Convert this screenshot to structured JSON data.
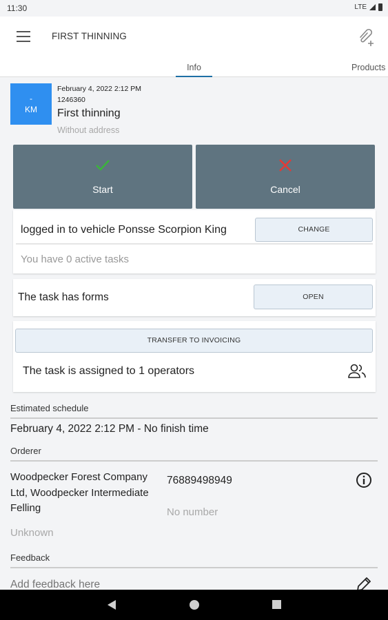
{
  "status_bar": {
    "time": "11:30",
    "network": "LTE"
  },
  "app_bar": {
    "title": "FIRST THINNING"
  },
  "tabs": [
    {
      "label": "Info"
    },
    {
      "label": "Products"
    }
  ],
  "task": {
    "avatar_top": "-",
    "avatar_bottom": "KM",
    "avatar_color": "#2f8ff0",
    "date": "February 4, 2022 2:12 PM",
    "number": "1246360",
    "name": "First thinning",
    "address": "Without address"
  },
  "actions": {
    "start_label": "Start",
    "start_color": "#3ab53a",
    "cancel_label": "Cancel",
    "cancel_color": "#e53935"
  },
  "vehicle": {
    "text": "logged in to vehicle Ponsse Scorpion King",
    "change_label": "CHANGE",
    "active_tasks": "You have 0 active tasks"
  },
  "forms": {
    "text": "The task has forms",
    "open_label": "OPEN"
  },
  "invoicing": {
    "transfer_label": "TRANSFER TO INVOICING",
    "assigned_text": "The task is assigned to 1 operators"
  },
  "schedule": {
    "title": "Estimated schedule",
    "value": "February 4, 2022 2:12 PM - No finish time"
  },
  "orderer": {
    "title": "Orderer",
    "name": "Woodpecker Forest Company Ltd, Woodpecker Intermediate Felling",
    "phone": "76889498949",
    "no_number": "No number",
    "unknown": "Unknown"
  },
  "feedback": {
    "title": "Feedback",
    "placeholder": "Add feedback here"
  }
}
